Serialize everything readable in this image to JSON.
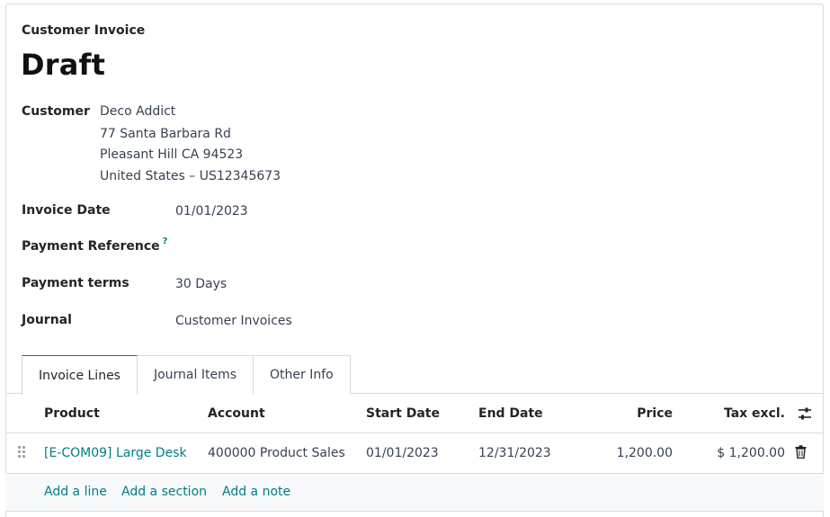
{
  "header": {
    "doc_type": "Customer Invoice",
    "state": "Draft"
  },
  "fields": {
    "customer_label": "Customer",
    "customer_name": "Deco Addict",
    "address_line1": "77 Santa Barbara Rd",
    "address_line2": "Pleasant Hill CA 94523",
    "address_line3": "United States – US12345673",
    "invoice_date_label": "Invoice Date",
    "invoice_date": "01/01/2023",
    "payment_ref_label": "Payment Reference",
    "payment_ref_help": "?",
    "payment_terms_label": "Payment terms",
    "payment_terms": "30 Days",
    "journal_label": "Journal",
    "journal": "Customer Invoices"
  },
  "tabs": [
    {
      "label": "Invoice Lines"
    },
    {
      "label": "Journal Items"
    },
    {
      "label": "Other Info"
    }
  ],
  "table": {
    "headers": [
      "Product",
      "Account",
      "Start Date",
      "End Date",
      "Price",
      "Tax excl."
    ],
    "rows": [
      [
        "[E-COM09] Large Desk",
        "400000 Product Sales",
        "01/01/2023",
        "12/31/2023",
        "1,200.00",
        "$ 1,200.00"
      ]
    ]
  },
  "actions": {
    "add_line": "Add a line",
    "add_section": "Add a section",
    "add_note": "Add a note"
  },
  "icons": {
    "column_settings": "sliders-icon",
    "delete": "trash-icon",
    "drag": "drag-handle-icon"
  },
  "colors": {
    "accent": "#017e84",
    "tab_active_border": "#714b67"
  }
}
